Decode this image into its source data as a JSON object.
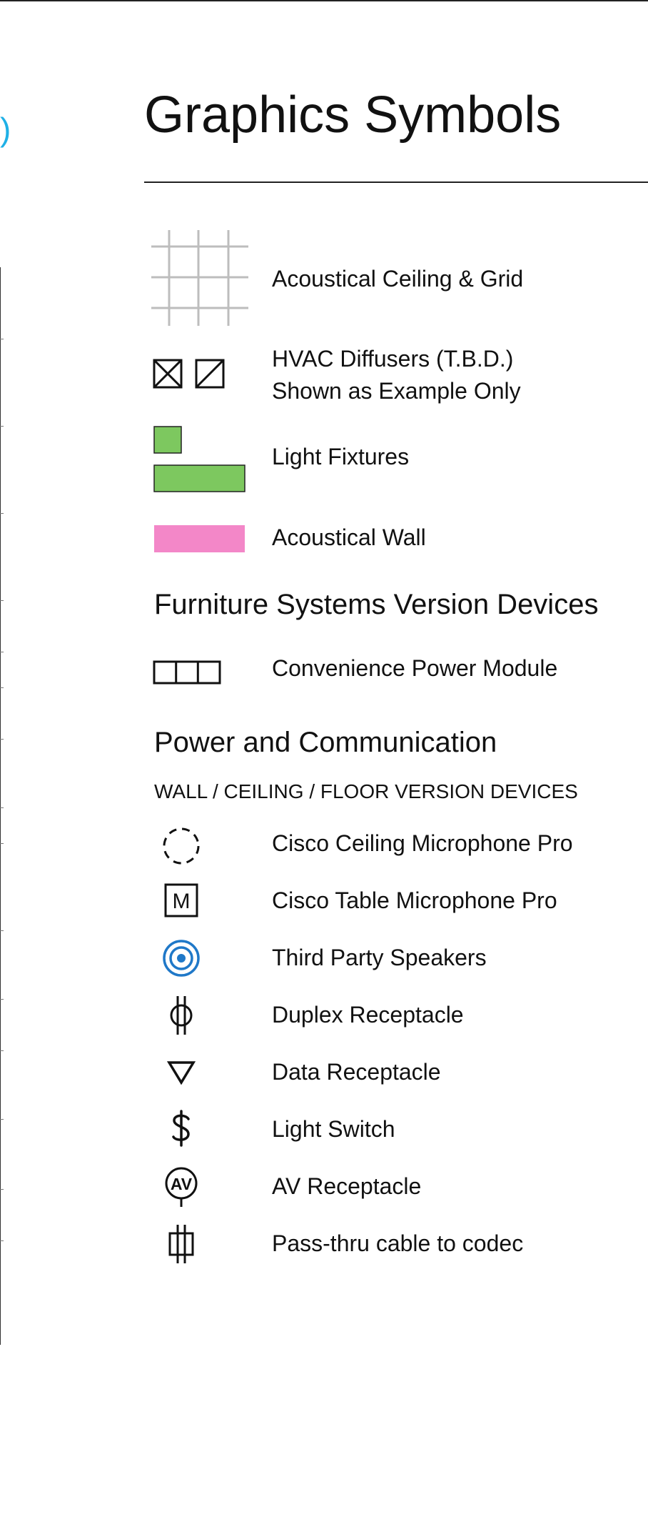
{
  "left_fragment": {
    "paren_text": ")",
    "paren_color": "#1fb0e6"
  },
  "page_title": "Graphics Symbols",
  "legend": {
    "ceiling_grid": "Acoustical Ceiling & Grid",
    "hvac_line1": "HVAC Diffusers (T.B.D.)",
    "hvac_line2": "Shown as Example Only",
    "light_fixtures": "Light Fixtures",
    "acoustical_wall": "Acoustical Wall"
  },
  "furniture": {
    "heading": "Furniture Systems Version Devices",
    "power_module": "Convenience Power Module"
  },
  "power": {
    "heading": "Power and Communication",
    "subheading": "WALL / CEILING / FLOOR VERSION DEVICES",
    "items": [
      "Cisco Ceiling Microphone Pro",
      "Cisco Table Microphone Pro",
      "Third Party Speakers",
      "Duplex Receptacle",
      "Data Receptacle",
      "Light Switch",
      "AV Receptacle",
      "Pass-thru cable to codec"
    ],
    "av_icon_text": "AV",
    "table_mic_icon_text": "M"
  },
  "colors": {
    "grid": "#bdbdbd",
    "light_fixture": "#7dc85f",
    "acoustical_wall": "#f387c8",
    "speaker": "#1f78c8",
    "line": "#111111"
  },
  "icons": [
    "ceiling-grid-icon",
    "hvac-diffuser-icons",
    "light-fixture-icons",
    "acoustical-wall-icon",
    "power-module-icon",
    "ceiling-mic-icon",
    "table-mic-icon",
    "speaker-icon",
    "duplex-receptacle-icon",
    "data-receptacle-icon",
    "light-switch-icon",
    "av-receptacle-icon",
    "pass-thru-icon"
  ]
}
